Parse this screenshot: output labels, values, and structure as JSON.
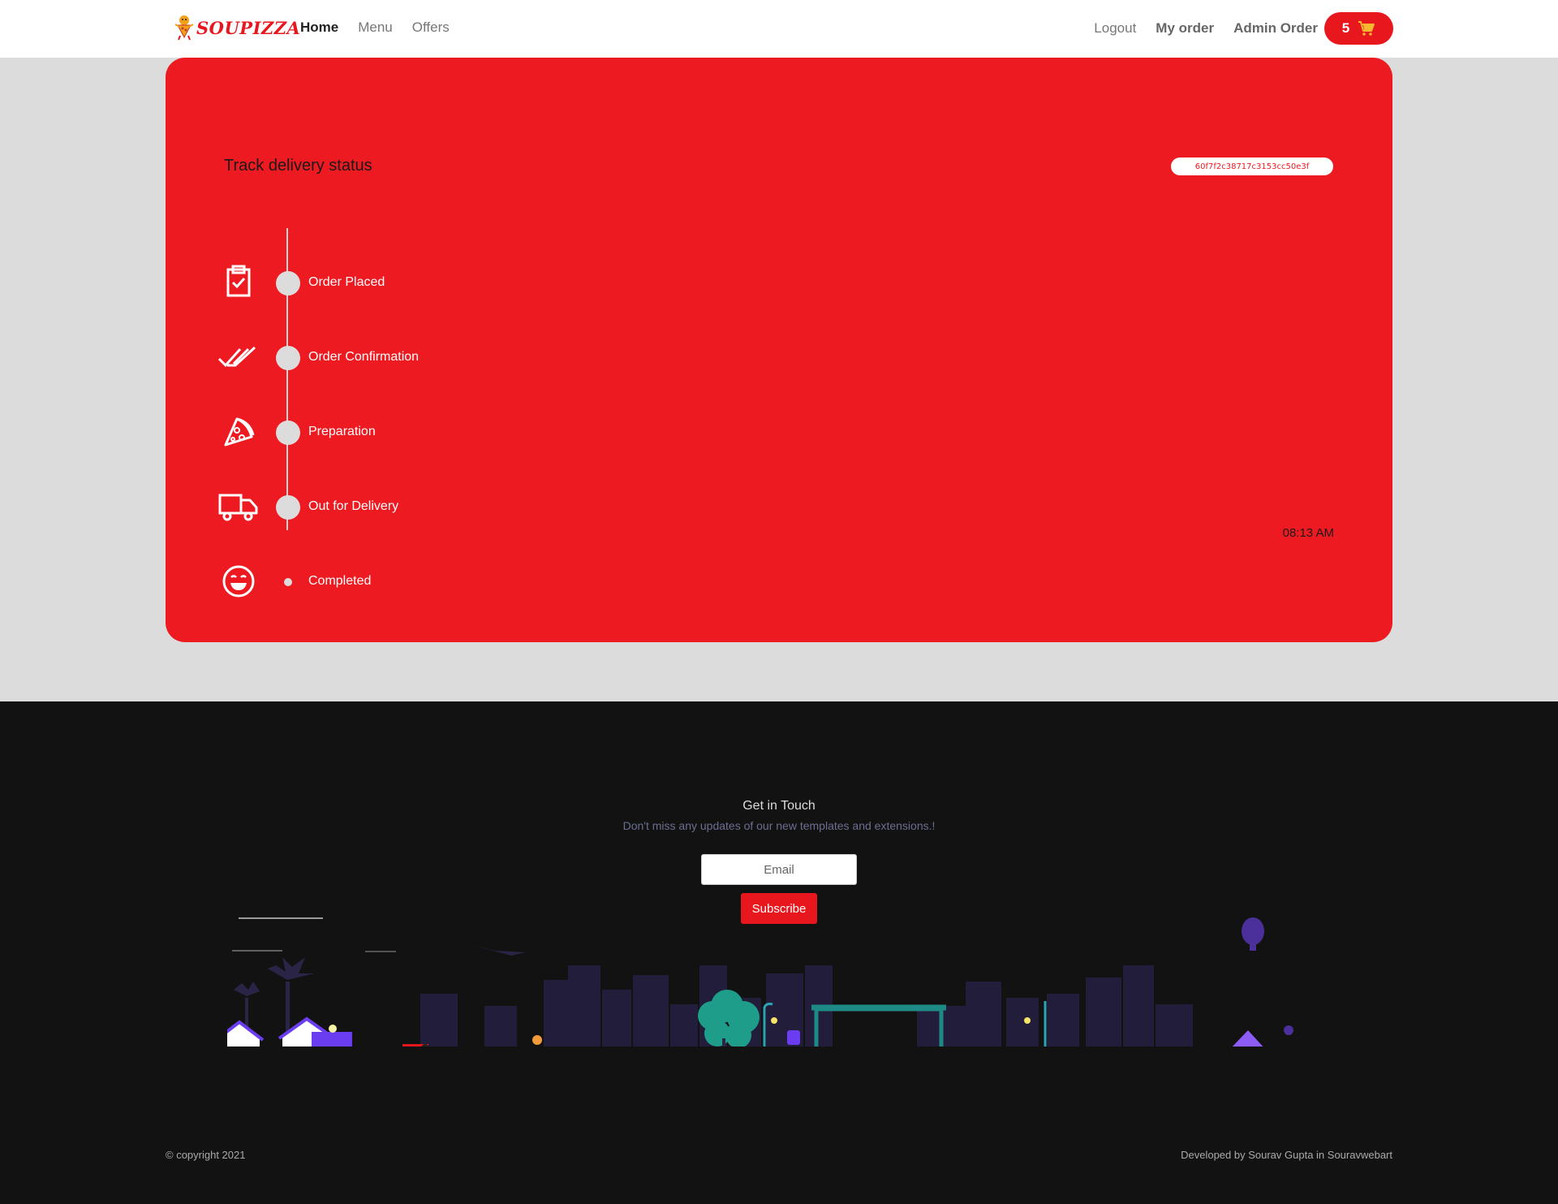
{
  "brand": {
    "name": "SOUPIZZA",
    "color": "#e8161d"
  },
  "nav": {
    "left": [
      "Home",
      "Menu",
      "Offers"
    ],
    "right": [
      "Logout",
      "My order",
      "Admin Order"
    ],
    "cart_count": "5"
  },
  "tracker": {
    "title": "Track delivery status",
    "order_id": "60f7f2c38717c3153cc50e3f",
    "time": "08:13 AM",
    "steps": [
      {
        "label": "Order Placed",
        "icon": "clipboard-check-icon"
      },
      {
        "label": "Order Confirmation",
        "icon": "double-check-icon"
      },
      {
        "label": "Preparation",
        "icon": "pizza-slice-icon"
      },
      {
        "label": "Out for Delivery",
        "icon": "truck-icon"
      },
      {
        "label": "Completed",
        "icon": "smile-icon"
      }
    ]
  },
  "footer": {
    "title": "Get in Touch",
    "subtitle": "Don't miss any updates of our new templates and extensions.!",
    "email_placeholder": "Email",
    "subscribe_label": "Subscribe",
    "copyright": "© copyright 2021",
    "developer": "Developed by Sourav Gupta in Souravwebart"
  }
}
